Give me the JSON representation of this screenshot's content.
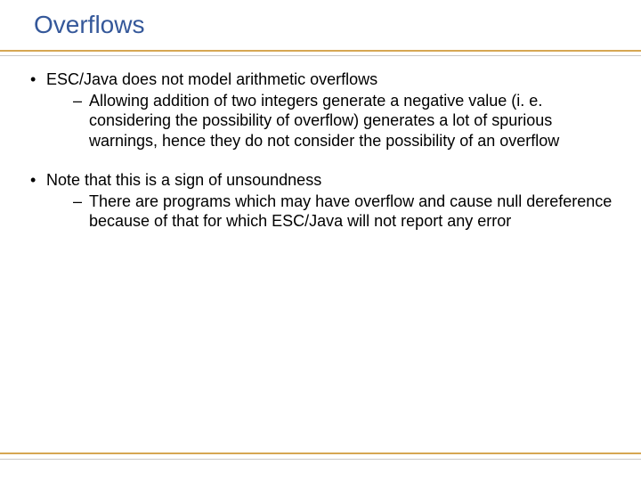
{
  "title": "Overflows",
  "bullets": [
    {
      "text": "ESC/Java does not model arithmetic overflows",
      "sub": [
        "Allowing addition of two integers generate a negative value (i. e. considering the possibility of overflow) generates a lot of spurious warnings, hence they do not consider the possibility of an overflow"
      ]
    },
    {
      "text": "Note that this is a sign of unsoundness",
      "sub": [
        "There are programs which may have overflow and cause null dereference because of that for which ESC/Java will not report any error"
      ]
    }
  ]
}
